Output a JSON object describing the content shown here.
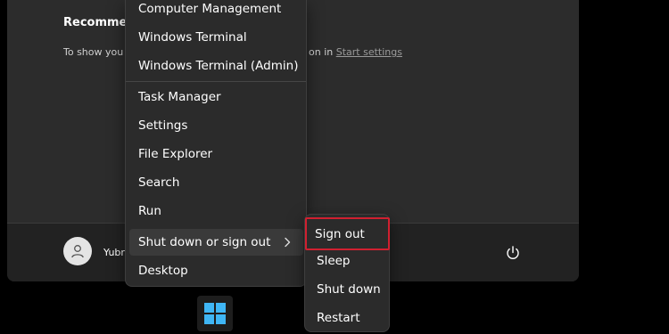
{
  "start_menu": {
    "recommended_heading": "Recommen",
    "hint_left": "To show you",
    "hint_right": "on in",
    "hint_link": "Start settings",
    "user_name": "Yubr"
  },
  "context_menu": {
    "items": [
      "Computer Management",
      "Windows Terminal",
      "Windows Terminal (Admin)",
      "Task Manager",
      "Settings",
      "File Explorer",
      "Search",
      "Run",
      "Shut down or sign out",
      "Desktop"
    ]
  },
  "submenu": {
    "items": [
      "Sign out",
      "Sleep",
      "Shut down",
      "Restart"
    ]
  },
  "icons": {
    "avatar": "user-icon",
    "power": "power-icon",
    "chevron": "chevron-right-icon",
    "start": "windows-logo-icon"
  },
  "colors": {
    "highlight_outline": "#d02030",
    "windows_logo": "#3fb6f5"
  }
}
